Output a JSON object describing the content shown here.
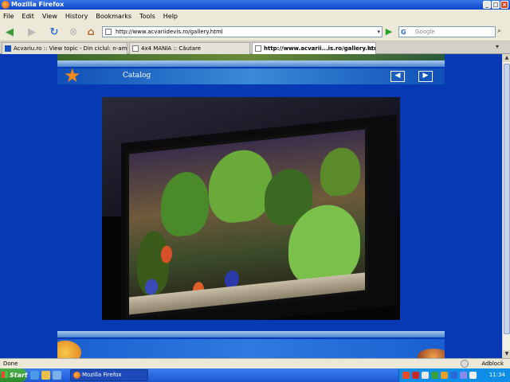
{
  "window": {
    "title": "Mozilla Firefox"
  },
  "menu": [
    "File",
    "Edit",
    "View",
    "History",
    "Bookmarks",
    "Tools",
    "Help"
  ],
  "nav": {
    "url": "http://www.acvariidevis.ro/gallery.html",
    "search_placeholder": "Google"
  },
  "tabs": [
    {
      "label": "Acvariu.ro :: View topic - Din ciclul: n-am ce ...",
      "active": false
    },
    {
      "label": "4x4 MANIA :: Căutare",
      "active": false
    },
    {
      "label": "http://www.acvarii...is.ro/gallery.html",
      "active": true
    }
  ],
  "page": {
    "catalog_label": "Catalog",
    "prev_label": "◀",
    "next_label": "▶"
  },
  "status": {
    "text": "Done",
    "adblock": "Adblock"
  },
  "taskbar": {
    "start_label": "Start",
    "task_label": "Mozilla Firefox",
    "clock": "11:34"
  },
  "colors": {
    "page_bg": "#0739b4",
    "accent": "#3a8ad6",
    "star": "#f08a1a"
  }
}
